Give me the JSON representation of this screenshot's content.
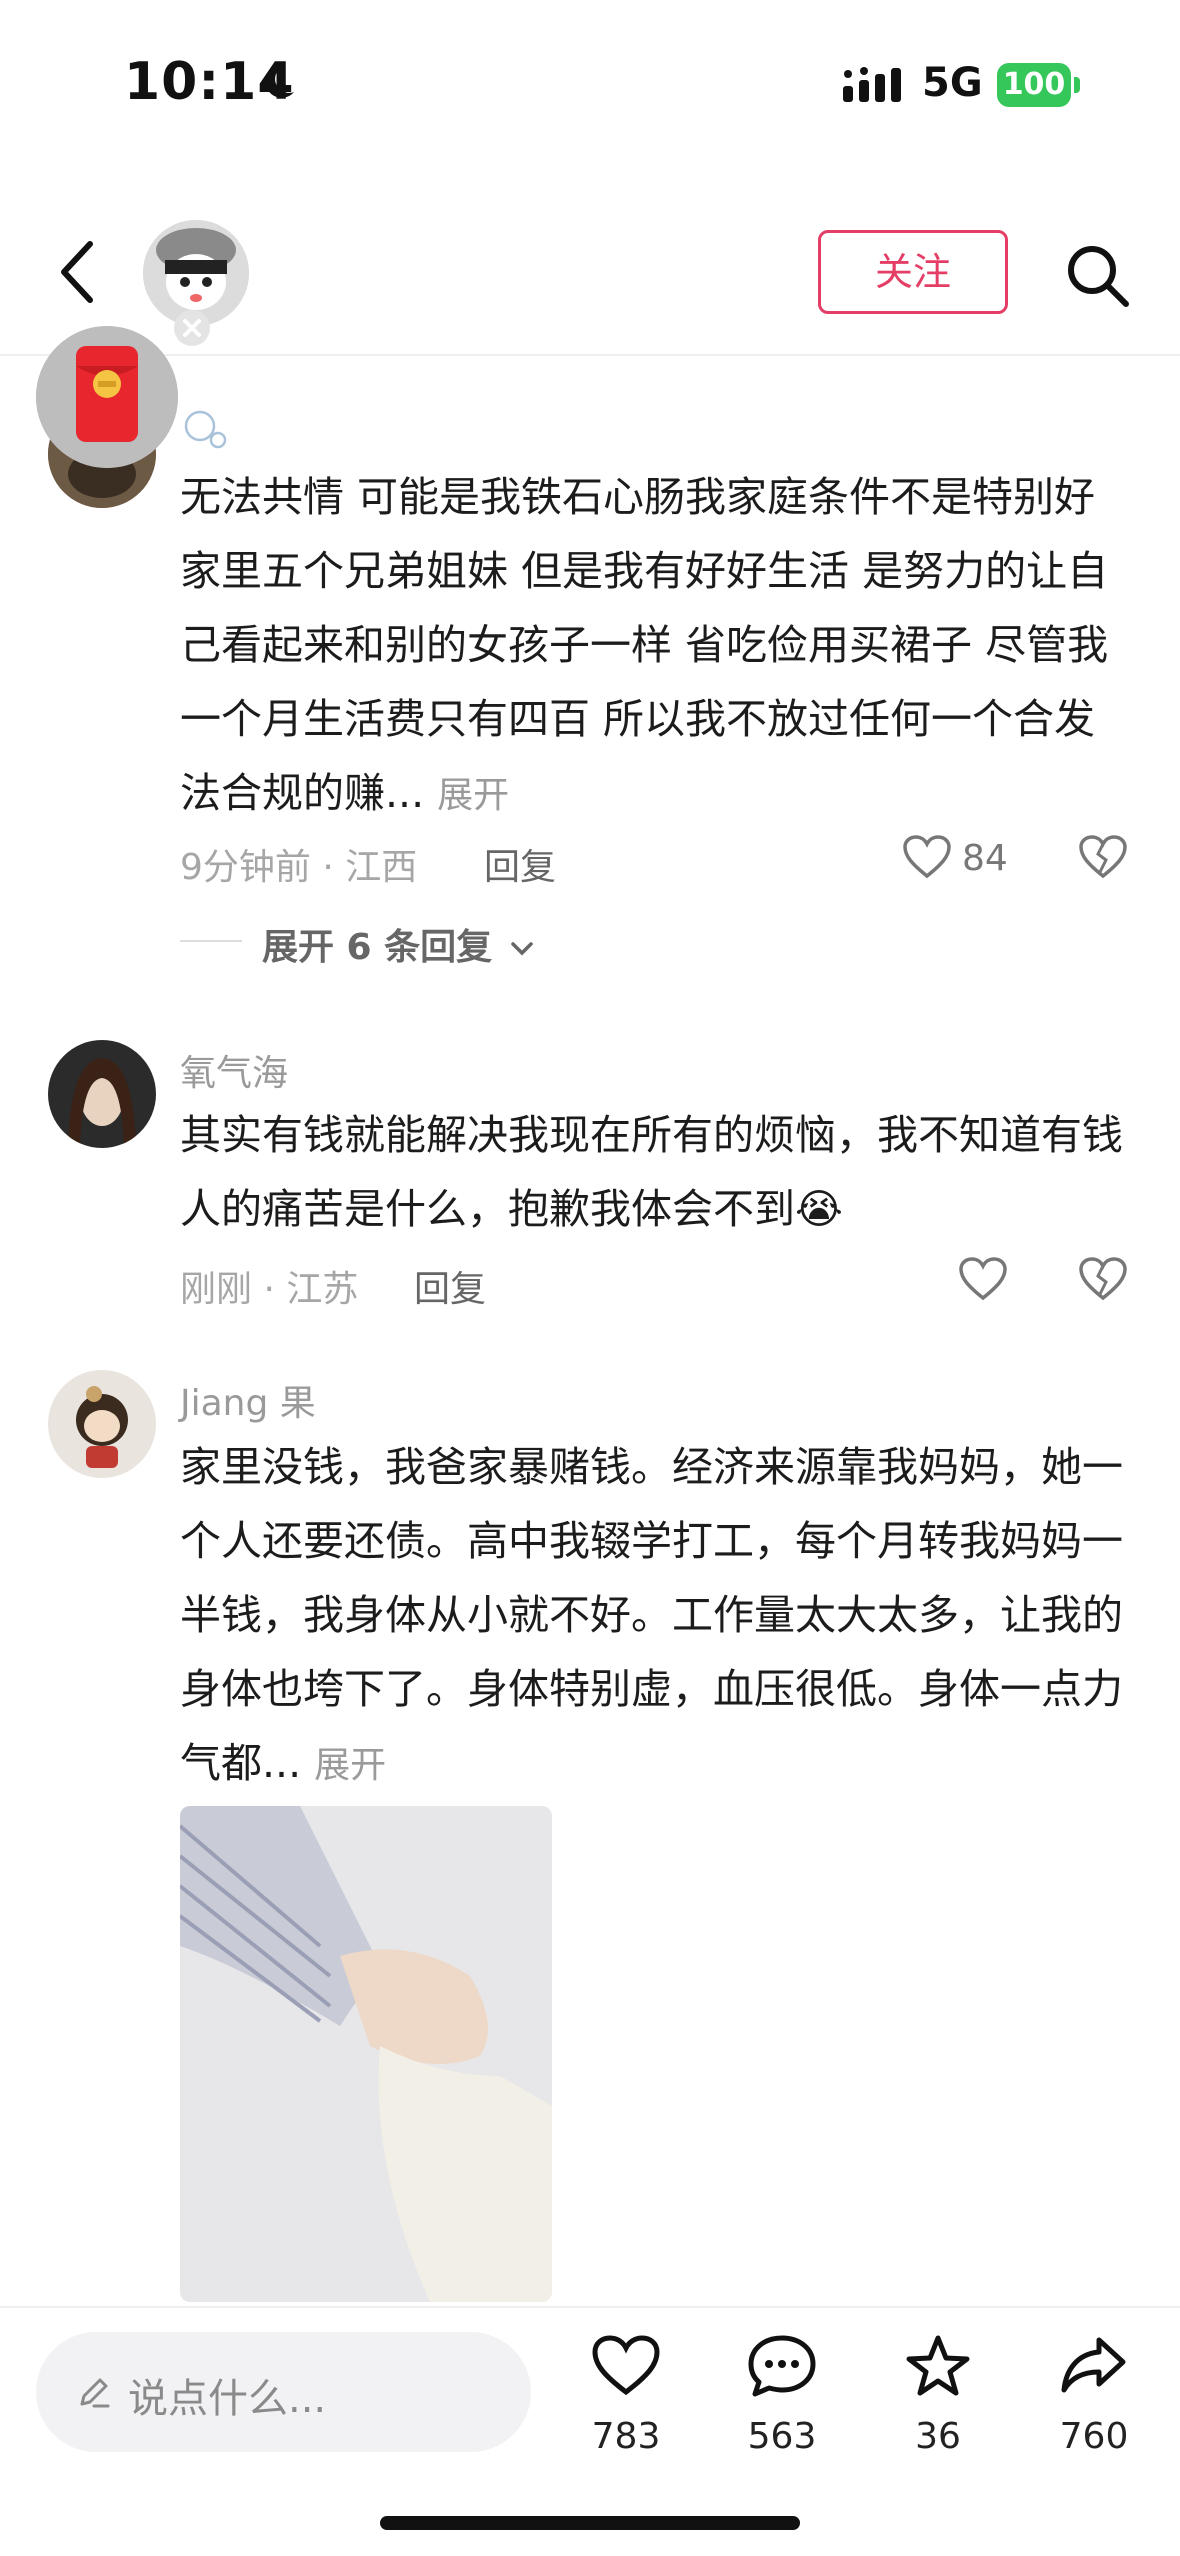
{
  "status_bar": {
    "time": "10:14",
    "network": "5G",
    "battery": "100",
    "moon_icon": "moon-icon",
    "signal_icon": "signal-bars-icon"
  },
  "header": {
    "back_icon": "chevron-left-icon",
    "follow_label": "关注",
    "search_icon": "search-icon"
  },
  "comments": [
    {
      "username": "",
      "text": "无法共情 可能是我铁石心肠我家庭条件不是特别好 家里五个兄弟姐妹 但是我有好好生活 是努力的让自己看起来和别的女孩子一样 省吃俭用买裙子 尽管我一个月生活费只有四百 所以我不放过任何一个合发法合规的赚...",
      "expand_label": "展开",
      "time_location": "9分钟前 · 江西",
      "reply_label": "回复",
      "likes": "84",
      "expand_replies": "展开 6 条回复"
    },
    {
      "username": "氧气海",
      "text": "其实有钱就能解决我现在所有的烦恼，我不知道有钱人的痛苦是什么，抱歉我体会不到😭",
      "time_location": "刚刚 · 江苏",
      "reply_label": "回复"
    },
    {
      "username": "Jiang 果",
      "text": "家里没钱，我爸家暴赌钱。经济来源靠我妈妈，她一个人还要还债。高中我辍学打工，每个月转我妈妈一半钱，我身体从小就不好。工作量太大太多，让我的身体也垮下了。身体特别虚，血压很低。身体一点力气都...",
      "expand_label": "展开"
    }
  ],
  "bottom_bar": {
    "input_placeholder": "说点什么...",
    "likes": "783",
    "comments": "563",
    "favorites": "36",
    "shares": "760"
  },
  "colors": {
    "accent": "#e53e66",
    "battery": "#35c759",
    "muted": "#9a9a9a"
  }
}
